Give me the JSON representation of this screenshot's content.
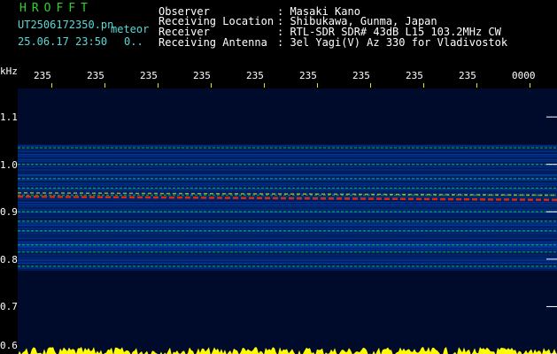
{
  "header": {
    "title": "HROFFT",
    "filename": "UT2506172350.pn",
    "mode": "meteor",
    "datetime": "25.06.17 23:50",
    "count": "0..",
    "observer_label": "Observer",
    "observer_value": ": Masaki Kano",
    "location_label": "Receiving Location",
    "location_value": ": Shibukawa, Gunma, Japan",
    "receiver_label": "Receiver",
    "receiver_value": ": RTL-SDR SDR# 43dB L15 103.2MHz CW",
    "antenna_label": "Receiving Antenna",
    "antenna_value": ": 3el Yagi(V) Az 330 for Vladivostok"
  },
  "axis": {
    "unit": "kHz",
    "time_ticks": [
      "235",
      "235",
      "235",
      "235",
      "235",
      "235",
      "235",
      "235",
      "235",
      "0000"
    ],
    "freq_ticks": [
      {
        "label": "1.1",
        "value": 1.1
      },
      {
        "label": "1.0",
        "value": 1.0
      },
      {
        "label": "0.9",
        "value": 0.9
      },
      {
        "label": "0.8",
        "value": 0.8
      },
      {
        "label": "0.7",
        "value": 0.7
      },
      {
        "label": "0.6",
        "value": 0.6
      }
    ],
    "freq_range": [
      0.6,
      1.16
    ]
  },
  "colors": {
    "background": "#000000",
    "waterfall_bg": "#000a2a",
    "signal_strong": "#ff2a00",
    "signal_mid": "#00ff40",
    "signal_low": "#0060ff",
    "meter": "#ffff00",
    "tick": "#e6e600"
  }
}
